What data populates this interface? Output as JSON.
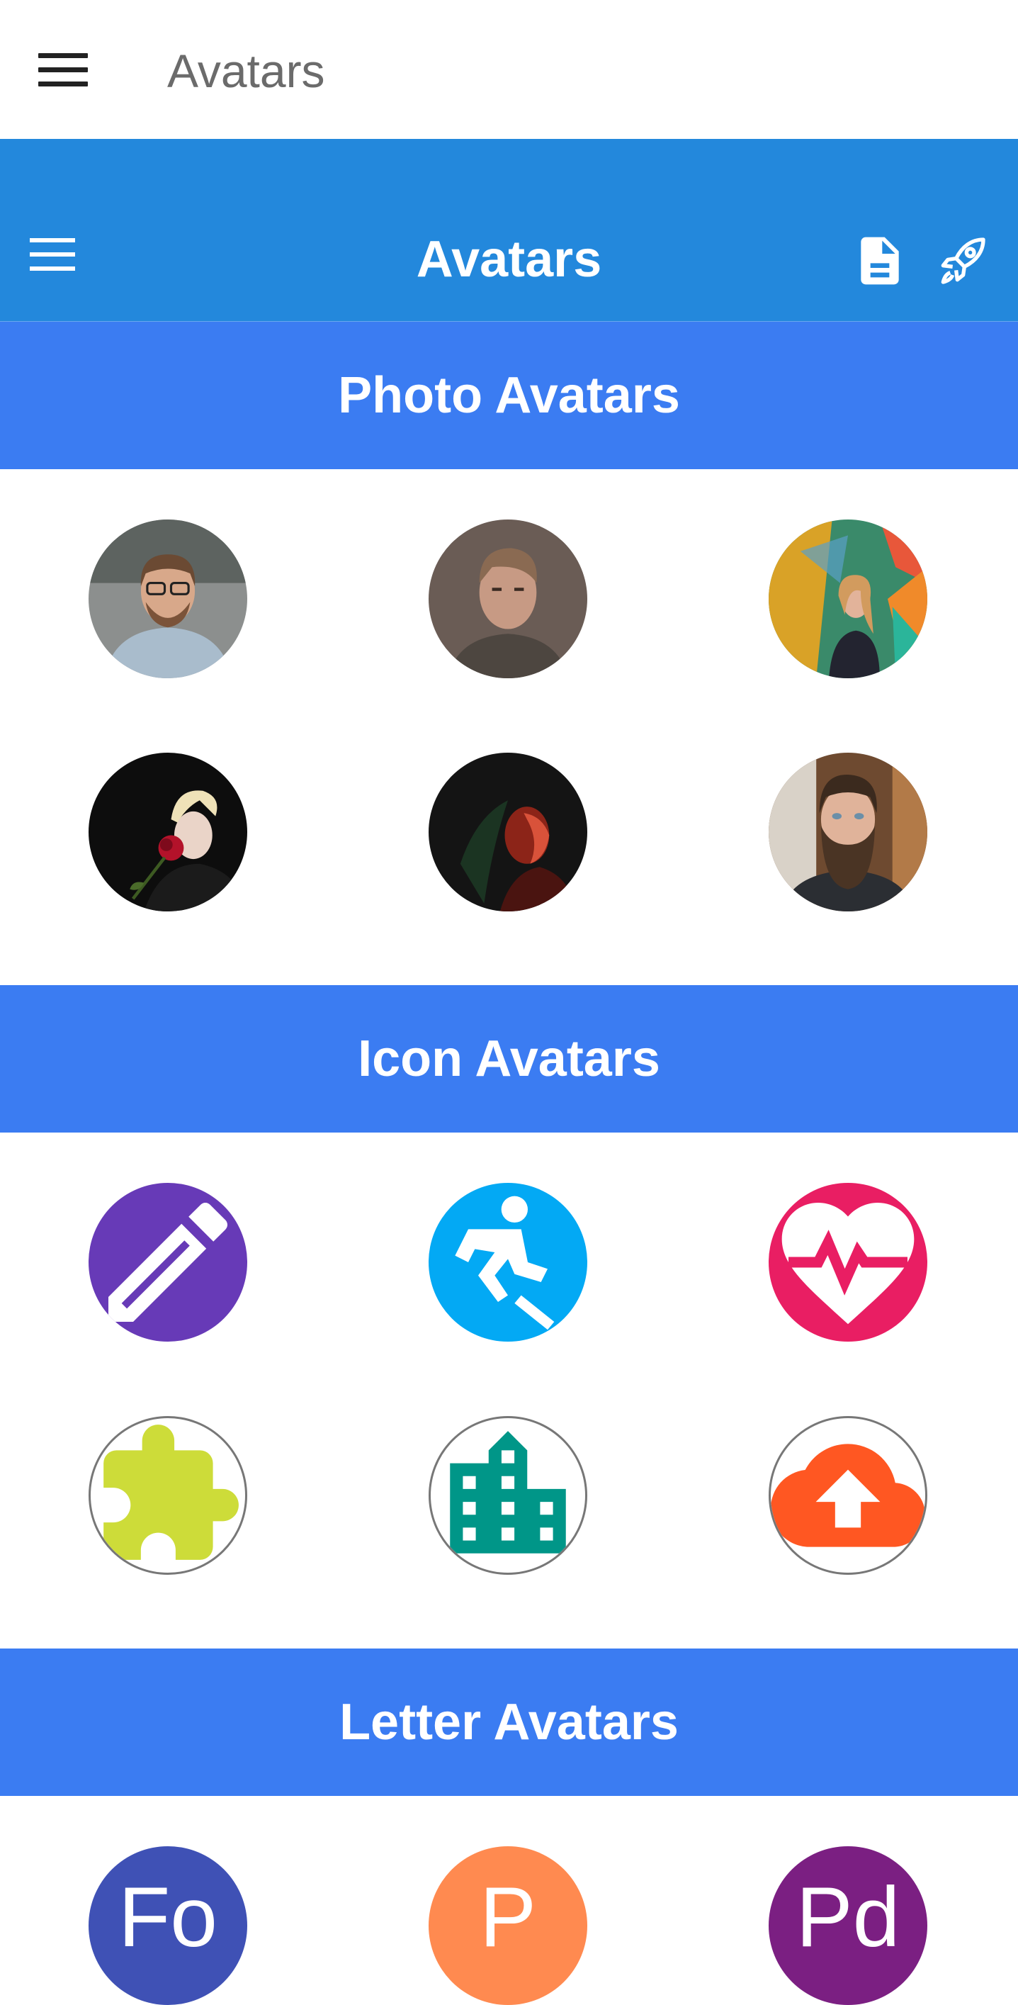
{
  "top": {
    "title": "Avatars"
  },
  "appbar": {
    "title": "Avatars",
    "doc_icon": "document-icon",
    "rocket_icon": "rocket-icon"
  },
  "sections": {
    "photo": "Photo Avatars",
    "icon": "Icon Avatars",
    "letter": "Letter Avatars"
  },
  "photo_avatars": [
    "man-with-glasses-photo",
    "man-portrait-photo",
    "woman-with-colorful-wall-photo",
    "woman-with-rose-photo",
    "woman-in-red-light-photo",
    "bearded-man-photo"
  ],
  "icon_avatars": [
    {
      "icon": "pencil-icon",
      "bg": "#673ab7",
      "fg": "#ffffff",
      "outlined": false
    },
    {
      "icon": "skater-icon",
      "bg": "#03a9f4",
      "fg": "#ffffff",
      "outlined": false
    },
    {
      "icon": "heart-pulse-icon",
      "bg": "#e91e63",
      "fg": "#ffffff",
      "outlined": false
    },
    {
      "icon": "puzzle-icon",
      "bg": "#ffffff",
      "fg": "#cddc39",
      "outlined": true
    },
    {
      "icon": "building-icon",
      "bg": "#ffffff",
      "fg": "#009688",
      "outlined": true
    },
    {
      "icon": "cloud-upload-icon",
      "bg": "#ffffff",
      "fg": "#ff5722",
      "outlined": true
    }
  ],
  "letter_avatars": [
    {
      "letter": "Fo",
      "bg": "#3f51b5"
    },
    {
      "letter": "P",
      "bg": "#ff8a50"
    },
    {
      "letter": "Pd",
      "bg": "#7b1f82"
    }
  ],
  "colors": {
    "appbar": "#2388dc",
    "section": "#3b7cf2"
  }
}
